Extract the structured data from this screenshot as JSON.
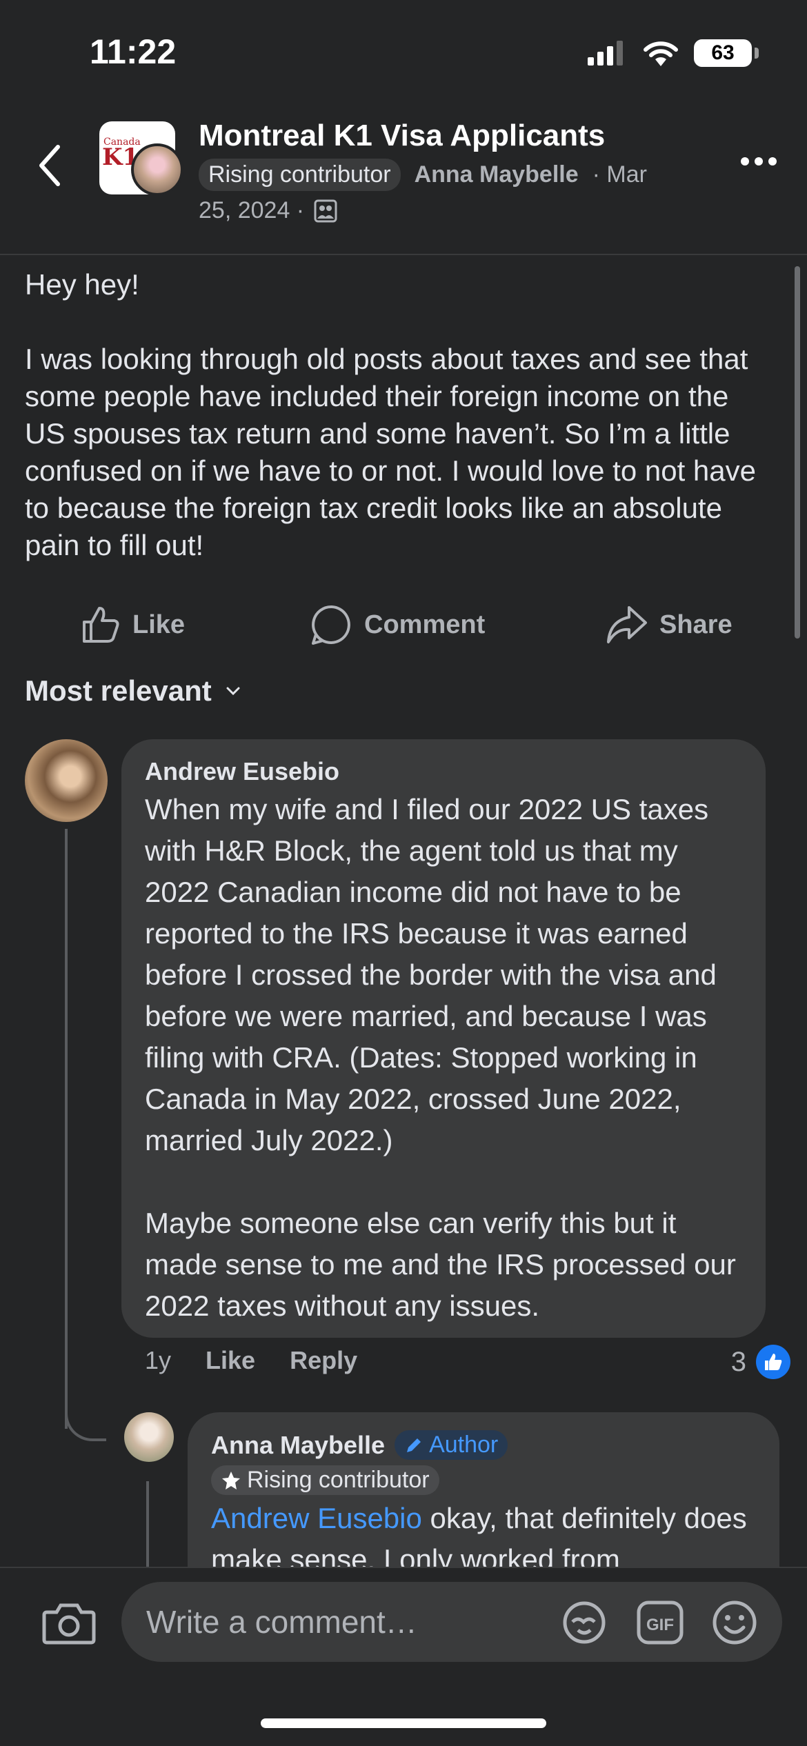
{
  "status": {
    "time": "11:22",
    "battery": "63"
  },
  "header": {
    "group_name": "Montreal K1 Visa Applicants",
    "badge": "Rising contributor",
    "author": "Anna Maybelle",
    "date_part1": "· Mar",
    "date_part2": "25, 2024 ·",
    "avatar_text_small": "Canada",
    "avatar_text_big": "K1"
  },
  "post": {
    "body": "Hey hey!\n\nI was looking through old posts about taxes and see that some people have included their foreign income on the US spouses tax return and some haven’t. So I’m a little confused on if we have to or not. I would love to not have to because the foreign tax credit looks like an absolute pain to fill out!"
  },
  "actions": {
    "like": "Like",
    "comment": "Comment",
    "share": "Share"
  },
  "sort": {
    "label": "Most relevant"
  },
  "comments": [
    {
      "name": "Andrew Eusebio",
      "text": "When my wife and I filed our 2022 US taxes with H&R Block, the agent told us that my 2022 Canadian income did not have to be reported to the IRS because it was earned before I crossed the border with the visa and before we were married, and because I was filing with CRA. (Dates: Stopped working in Canada in May 2022, crossed June 2022, married July 2022.)\n\nMaybe someone else can verify this but it made sense to me and the IRS processed our 2022 taxes without any issues.",
      "age": "1y",
      "like": "Like",
      "reply": "Reply",
      "reactions": "3"
    },
    {
      "name": "Anna Maybelle",
      "author_badge": "Author",
      "contrib_badge": "Rising contributor",
      "mention": "Andrew Eusebio",
      "text": " okay, that definitely does make sense. I only worked from"
    }
  ],
  "composer": {
    "placeholder": "Write a comment…"
  },
  "colors": {
    "background": "#242526",
    "bubble": "#3a3b3c",
    "accent": "#1877f2",
    "link": "#4599ff"
  },
  "icons": [
    "back-icon",
    "more-icon",
    "like-icon",
    "comment-icon",
    "share-icon",
    "chevron-down-icon",
    "thumbs-up-icon",
    "pencil-icon",
    "star-icon",
    "camera-icon",
    "avatar-sticker-icon",
    "gif-icon",
    "emoji-icon",
    "members-icon"
  ]
}
